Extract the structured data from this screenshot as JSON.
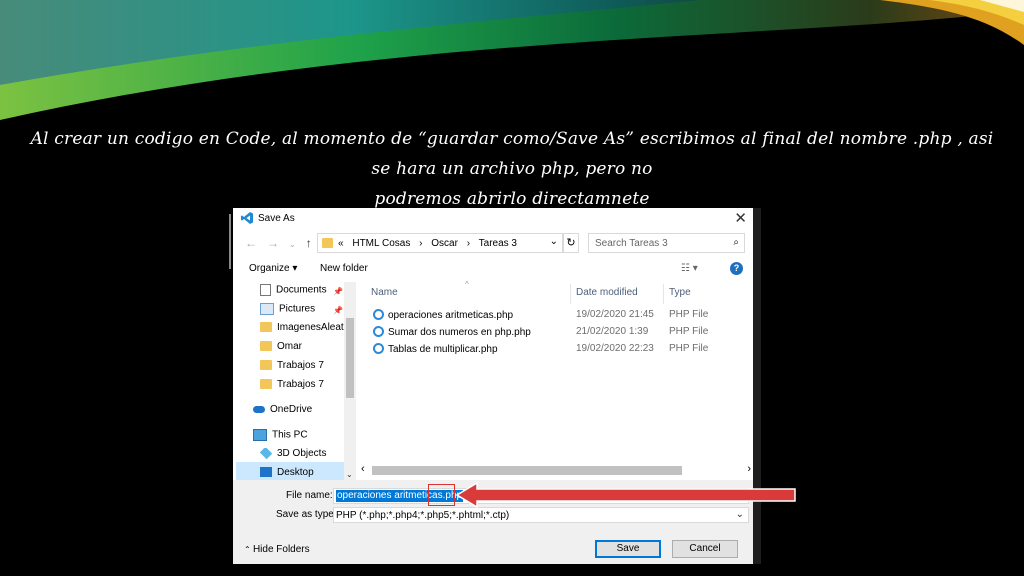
{
  "slide": {
    "caption_line1": "Al crear un codigo en Code, al momento de “guardar como/Save As” escribimos al final del nombre .php , asi se hara un archivo php, pero no",
    "caption_line2": "podremos abrirlo directamnete"
  },
  "dialog": {
    "title": "Save As",
    "close": "✕",
    "breadcrumbs": [
      "«",
      "HTML Cosas",
      "›",
      "Oscar",
      "›",
      "Tareas 3"
    ],
    "search_placeholder": "Search Tareas 3",
    "toolbar": {
      "organize": "Organize ▾",
      "new_folder": "New folder",
      "view": "☷ ▾",
      "help": "?"
    },
    "nav_items": [
      {
        "label": "Documents",
        "icon": "documents-icon",
        "pinned": true
      },
      {
        "label": "Pictures",
        "icon": "pictures-icon",
        "pinned": true
      },
      {
        "label": "ImagenesAleato",
        "icon": "folder-icon"
      },
      {
        "label": "Omar",
        "icon": "folder-icon"
      },
      {
        "label": "Trabajos 7",
        "icon": "folder-icon"
      },
      {
        "label": "Trabajos 7",
        "icon": "folder-icon"
      },
      {
        "label": "OneDrive",
        "icon": "onedrive-icon"
      },
      {
        "label": "This PC",
        "icon": "pc-icon"
      },
      {
        "label": "3D Objects",
        "icon": "3d-objects-icon"
      },
      {
        "label": "Desktop",
        "icon": "desktop-icon",
        "selected": true
      }
    ],
    "columns": {
      "name": "Name",
      "date": "Date modified",
      "type": "Type"
    },
    "files": [
      {
        "name": "operaciones aritmeticas.php",
        "date": "19/02/2020 21:45",
        "type": "PHP File"
      },
      {
        "name": "Sumar dos numeros en php.php",
        "date": "21/02/2020 1:39",
        "type": "PHP File"
      },
      {
        "name": "Tablas de multiplicar.php",
        "date": "19/02/2020 22:23",
        "type": "PHP File"
      }
    ],
    "file_name_label": "File name:",
    "file_name_value": "operaciones aritmeticas.php",
    "save_type_label": "Save as type:",
    "save_type_value": "PHP (*.php;*.php4;*.php5;*.phtml;*.ctp)",
    "hide_folders": "Hide Folders",
    "save_button": "Save",
    "cancel_button": "Cancel"
  },
  "colors": {
    "accent": "#0078d7",
    "annotation_red": "#e03030",
    "folder": "#f3c65a"
  }
}
